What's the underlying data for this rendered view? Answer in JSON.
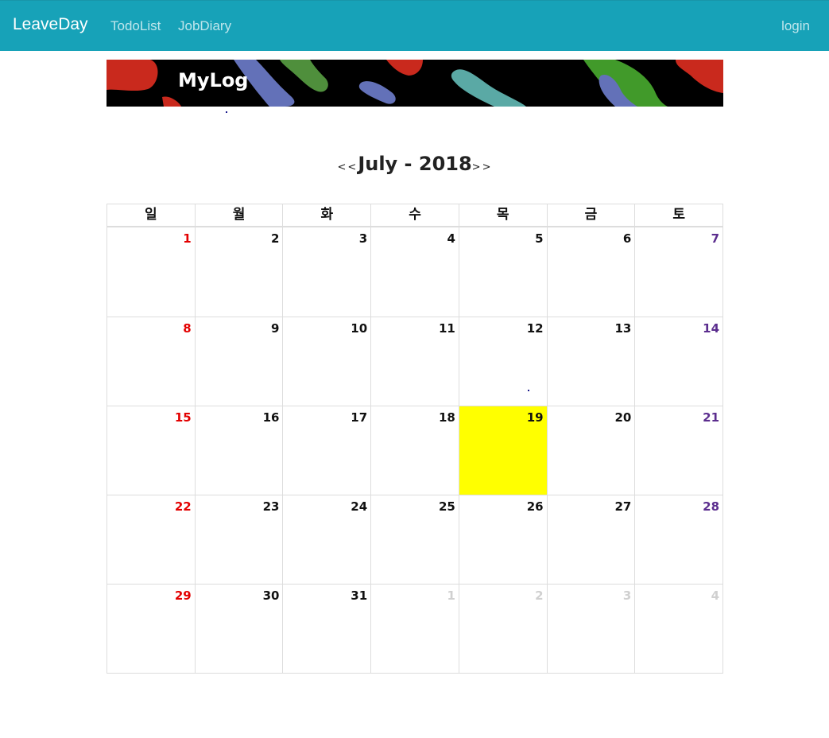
{
  "navbar": {
    "brand": "LeaveDay",
    "links": [
      "TodoList",
      "JobDiary"
    ],
    "login": "login",
    "color": "#17a2b8"
  },
  "banner": {
    "title": "MyLog"
  },
  "calendar": {
    "prev_label": "<<",
    "next_label": ">>",
    "title": "July - 2018",
    "weekdays": [
      "일",
      "월",
      "화",
      "수",
      "목",
      "금",
      "토"
    ],
    "weeks": [
      [
        "1",
        "2",
        "3",
        "4",
        "5",
        "6",
        "7"
      ],
      [
        "8",
        "9",
        "10",
        "11",
        "12",
        "13",
        "14"
      ],
      [
        "15",
        "16",
        "17",
        "18",
        "19",
        "20",
        "21"
      ],
      [
        "22",
        "23",
        "24",
        "25",
        "26",
        "27",
        "28"
      ],
      [
        "29",
        "30",
        "31",
        "1",
        "2",
        "3",
        "4"
      ]
    ],
    "today": "19",
    "today_color": "#ffff00",
    "sunday_color": "#e30000",
    "saturday_color": "#5b2d8e",
    "other_month_color": "#d0d0d0"
  }
}
